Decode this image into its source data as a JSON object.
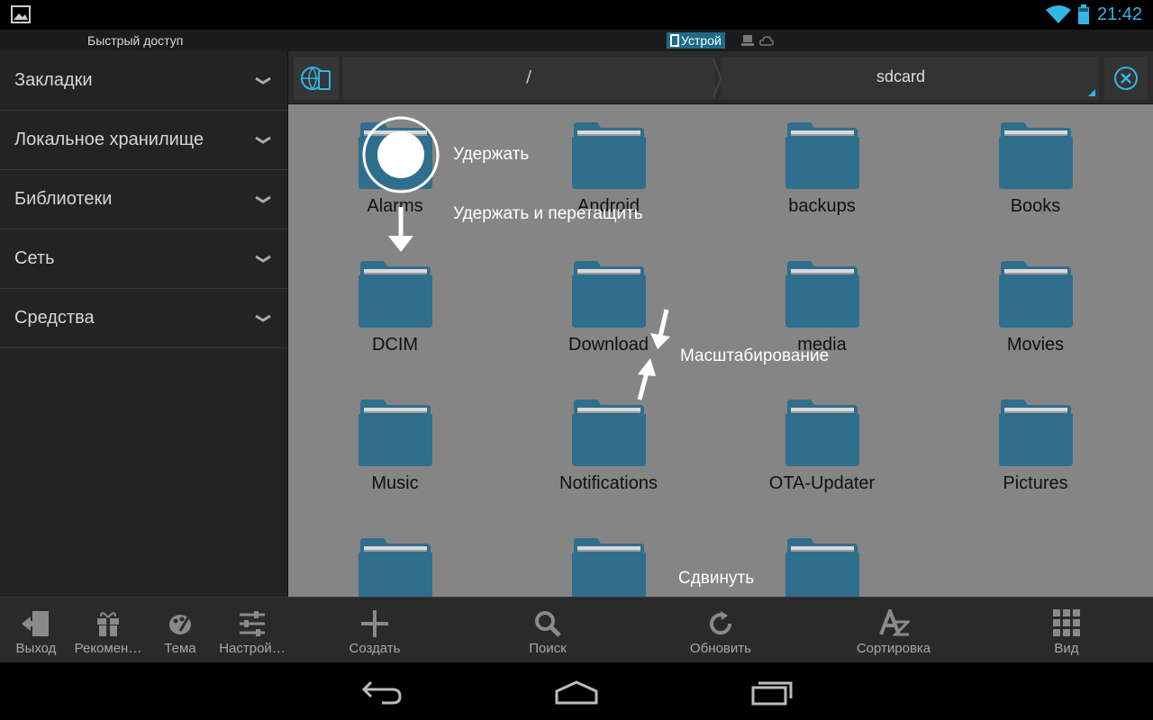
{
  "status_bar": {
    "time": "21:42",
    "icons": [
      "gallery-icon",
      "wifi-icon",
      "battery-icon"
    ],
    "accent_color": "#33b5e5"
  },
  "header": {
    "quick_access_title": "Быстрый доступ",
    "storage_tab": "Устрой"
  },
  "sidebar": {
    "items": [
      {
        "label": "Закладки"
      },
      {
        "label": "Локальное хранилище"
      },
      {
        "label": "Библиотеки"
      },
      {
        "label": "Сеть"
      },
      {
        "label": "Средства"
      }
    ],
    "toolbar": [
      {
        "label": "Выход",
        "icon": "exit-icon"
      },
      {
        "label": "Рекомен…",
        "icon": "gift-icon"
      },
      {
        "label": "Тема",
        "icon": "palette-icon"
      },
      {
        "label": "Настрой…",
        "icon": "settings-sliders-icon"
      }
    ]
  },
  "path_bar": {
    "root": "/",
    "current": "sdcard"
  },
  "folders": [
    {
      "name": "Alarms"
    },
    {
      "name": "Android"
    },
    {
      "name": "backups"
    },
    {
      "name": "Books"
    },
    {
      "name": "DCIM"
    },
    {
      "name": "Download"
    },
    {
      "name": "media"
    },
    {
      "name": "Movies"
    },
    {
      "name": "Music"
    },
    {
      "name": "Notifications"
    },
    {
      "name": "OTA-Updater"
    },
    {
      "name": "Pictures"
    },
    {
      "name": ""
    },
    {
      "name": ""
    },
    {
      "name": ""
    }
  ],
  "gesture_hints": {
    "hold": "Удержать",
    "hold_drag": "Удержать и перетащить",
    "zoom": "Масштабирование",
    "swipe": "Сдвинуть"
  },
  "main_toolbar": [
    {
      "label": "Создать",
      "icon": "plus-icon"
    },
    {
      "label": "Поиск",
      "icon": "search-icon"
    },
    {
      "label": "Обновить",
      "icon": "refresh-icon"
    },
    {
      "label": "Сортировка",
      "icon": "sort-az-icon"
    },
    {
      "label": "Вид",
      "icon": "grid-view-icon"
    }
  ],
  "colors": {
    "folder": "#2f6e8c",
    "grid_background": "#858585",
    "sidebar_background": "#232323"
  }
}
